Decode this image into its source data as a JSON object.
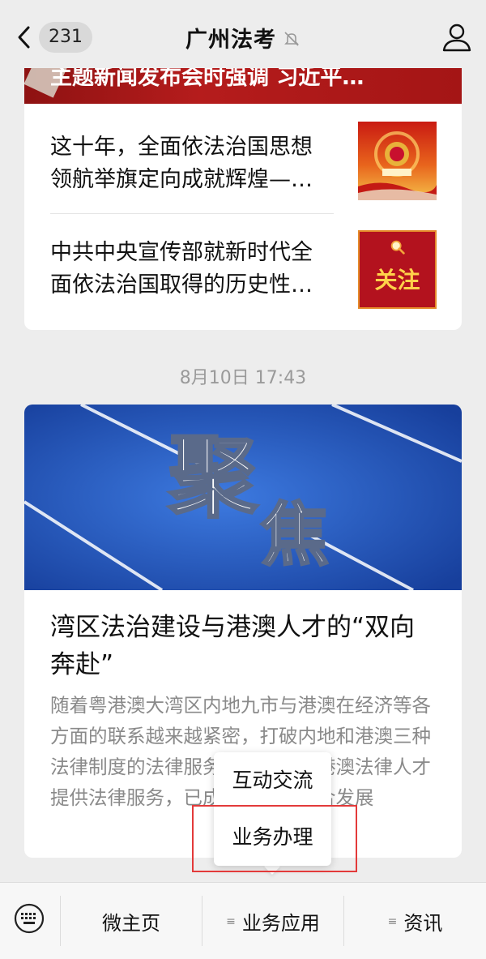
{
  "header": {
    "back_count": "231",
    "title": "广州法考"
  },
  "card1": {
    "banner_text": "主题新闻发布会时强调 习近平…",
    "articles": [
      {
        "title": "这十年，全面依法治国思想领航举旗定向成就辉煌—…"
      },
      {
        "title": "中共中央宣传部就新时代全面依法治国取得的历史性…",
        "thumb_text": "关注"
      }
    ]
  },
  "timestamp": "8月10日 17:43",
  "feature": {
    "cover_text_1": "聚",
    "cover_text_2": "焦",
    "title": "湾区法治建设与港澳人才的“双向奔赴”",
    "desc": "随着粤港澳大湾区内地九市与港澳在经济等各方面的联系越来越紧密，打破内地和港澳三种法律制度的法律服务壁垒，吸纳港澳法律人才提供法律服务，已成为大湾区融合发展"
  },
  "popup": {
    "items": [
      "互动交流",
      "业务办理"
    ]
  },
  "bottom_bar": {
    "items": [
      "微主页",
      "业务应用",
      "资讯"
    ]
  },
  "colors": {
    "page_bg": "#ededed",
    "banner_red": "#b51c1c",
    "highlight": "#e33a3a",
    "cover_blue": "#1f4fb5"
  }
}
